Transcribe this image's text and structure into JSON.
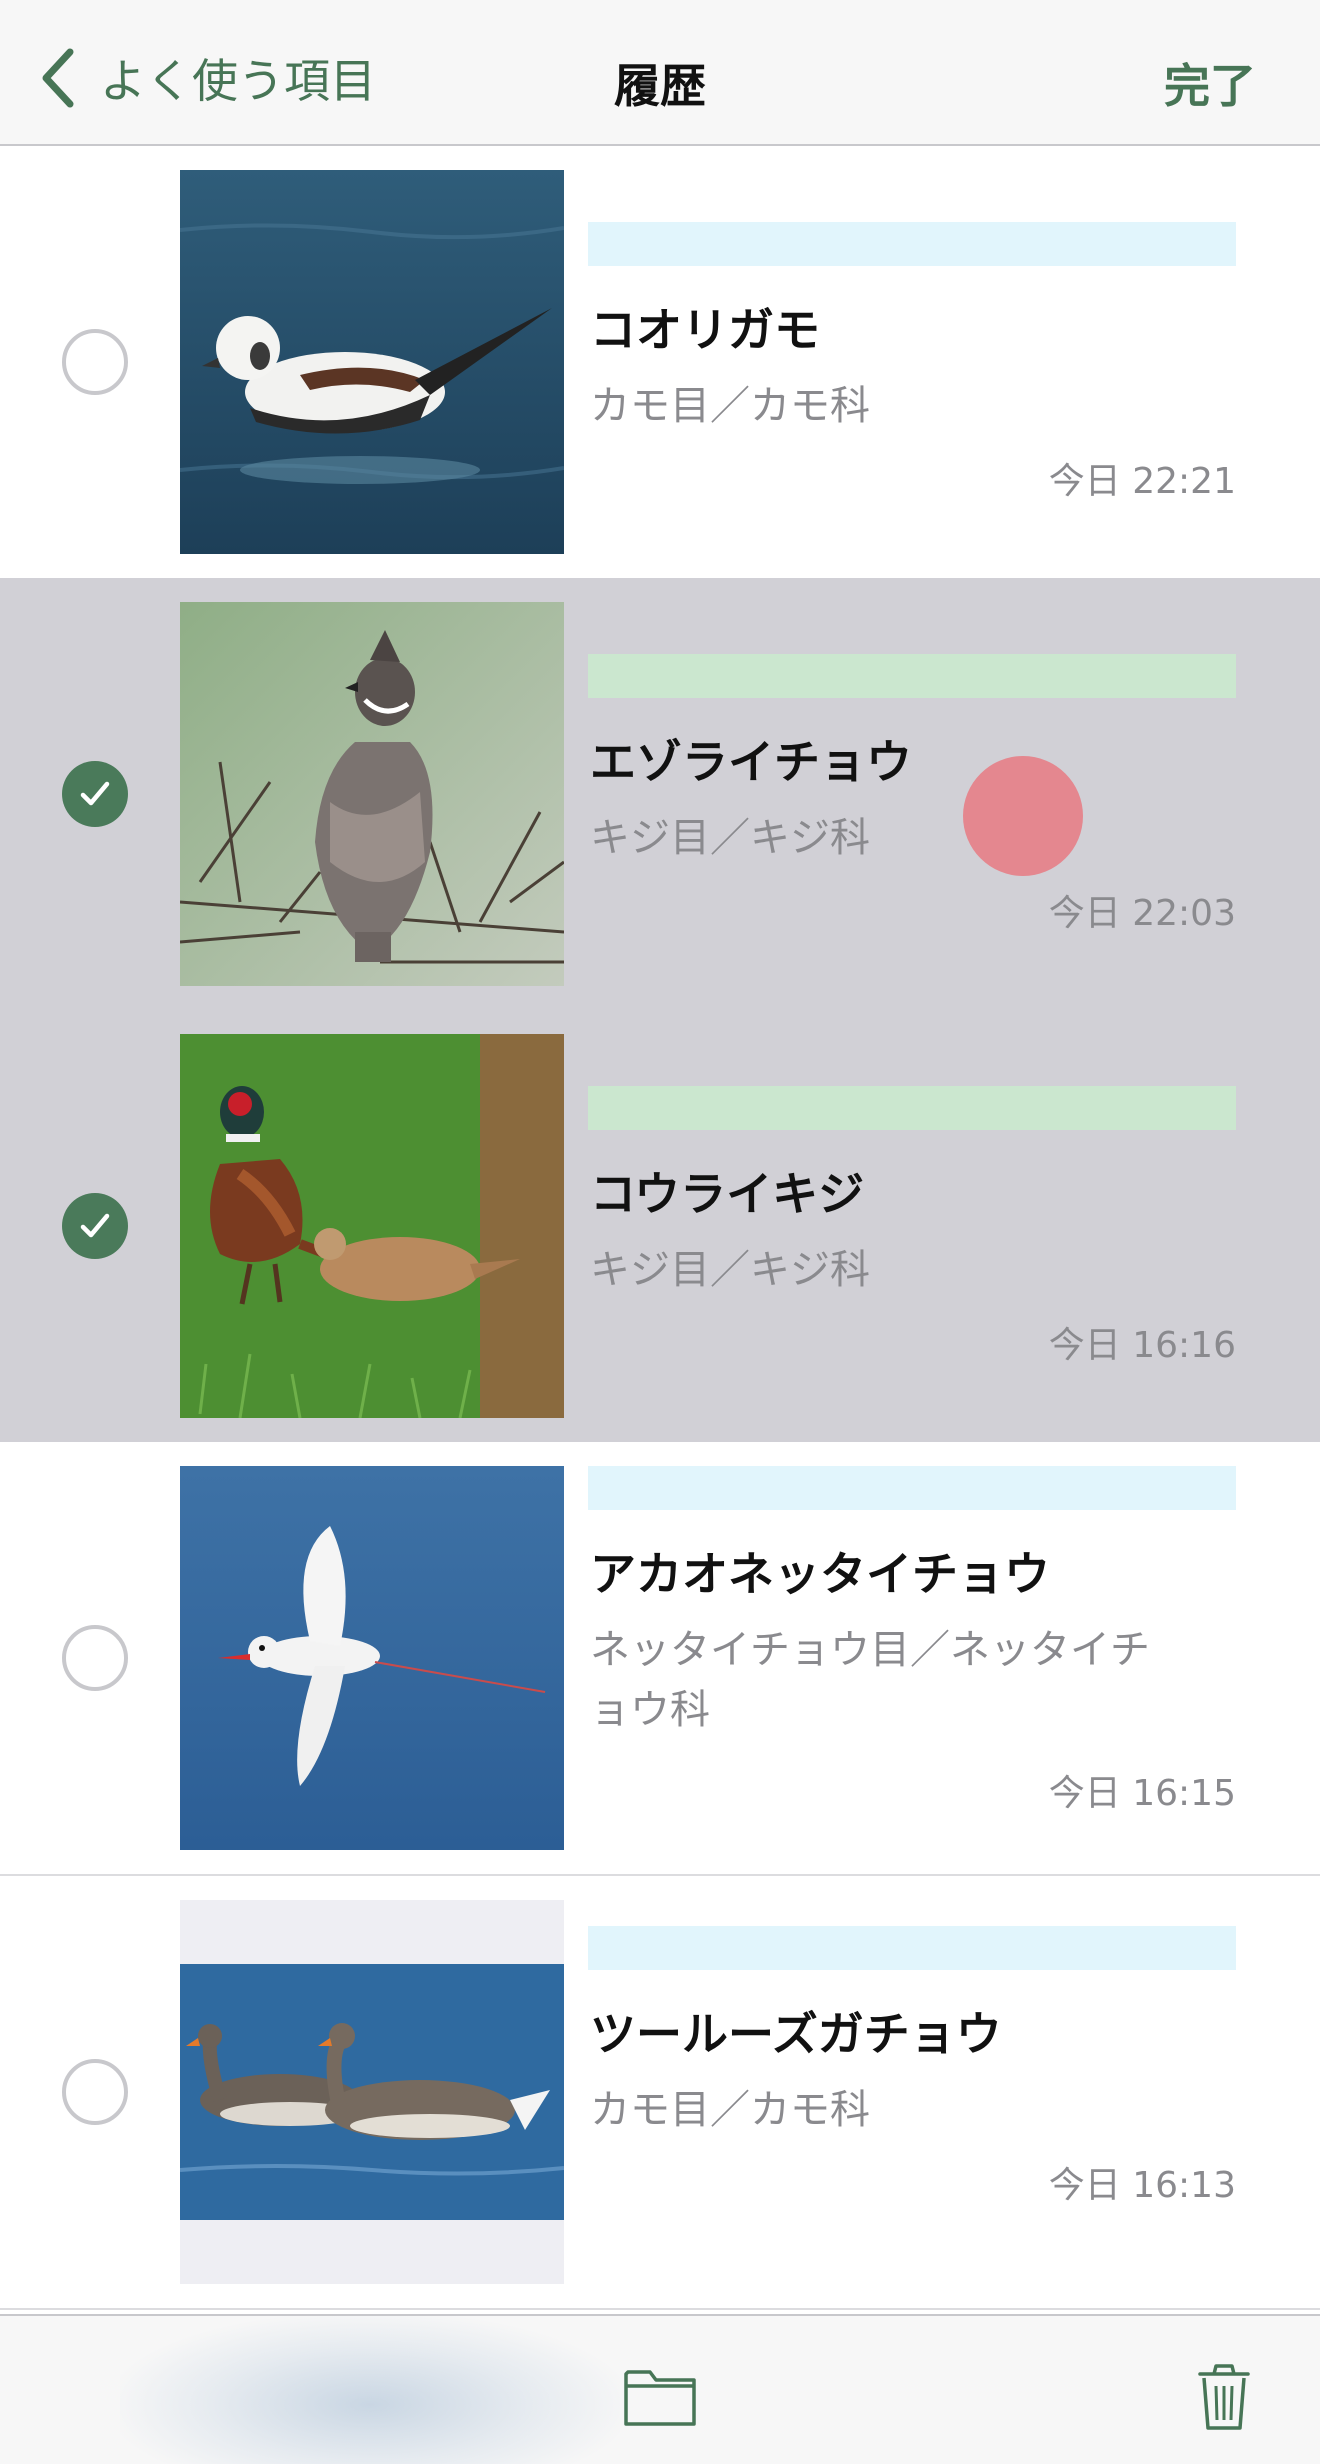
{
  "nav": {
    "back_label": "よく使う項目",
    "title": "履歴",
    "done_label": "完了"
  },
  "colors": {
    "accent": "#477556",
    "selected_row": "#d1d0d6",
    "tag_blue": "#e1f5fc",
    "tag_green": "#cbe7cf",
    "touch_indicator": "#ec6b73"
  },
  "rows": [
    {
      "name": "コオリガモ",
      "taxon": "カモ目／カモ科",
      "time": "今日 22:21",
      "selected": false,
      "tag_color": "#e1f5fc",
      "image": "long-tailed-duck"
    },
    {
      "name": "エゾライチョウ",
      "taxon": "キジ目／キジ科",
      "time": "今日 22:03",
      "selected": true,
      "tag_color": "#cbe7cf",
      "image": "hazel-grouse"
    },
    {
      "name": "コウライキジ",
      "taxon": "キジ目／キジ科",
      "time": "今日 16:16",
      "selected": true,
      "tag_color": "#cbe7cf",
      "image": "ring-necked-pheasant"
    },
    {
      "name": "アカオネッタイチョウ",
      "taxon": "ネッタイチョウ目／ネッタイチョウ科",
      "time": "今日 16:15",
      "selected": false,
      "tag_color": "#e1f5fc",
      "image": "red-tailed-tropicbird"
    },
    {
      "name": "ツールーズガチョウ",
      "taxon": "カモ目／カモ科",
      "time": "今日 16:13",
      "selected": false,
      "tag_color": "#e1f5fc",
      "image": "toulouse-geese"
    }
  ],
  "toolbar": {
    "items": [
      "folder-icon",
      "trash-icon"
    ]
  }
}
